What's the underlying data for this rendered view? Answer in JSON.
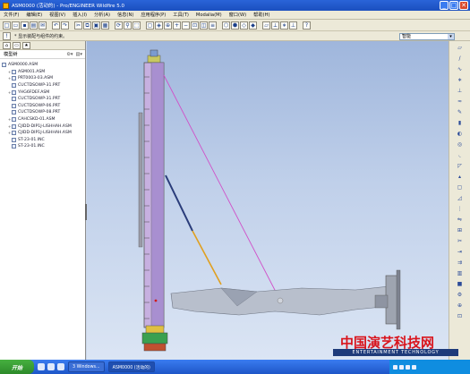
{
  "window": {
    "title": "ASM0000 (活动的) - Pro/ENGINEER Wildfire 5.0",
    "buttons": [
      "_",
      "□",
      "✕"
    ]
  },
  "menubar": {
    "items": [
      "文件(F)",
      "编辑(E)",
      "视图(V)",
      "插入(I)",
      "分析(A)",
      "信息(N)",
      "应用程序(P)",
      "工具(T)",
      "Modalia(M)",
      "窗口(W)",
      "帮助(H)"
    ]
  },
  "toolbar": {
    "message": "* 显示装配与组件的约束。",
    "smart_filter": "智能"
  },
  "model_tree": {
    "header": "模型树",
    "items": [
      {
        "label": "ASM0000.ASM",
        "level": 0
      },
      {
        "label": "ASM001.ASM",
        "level": 1
      },
      {
        "label": "PRT0003-03.ASM",
        "level": 1
      },
      {
        "label": "CUCTDSOWP-31.PRT",
        "level": 1
      },
      {
        "label": "YHG6FDEF.ASM",
        "level": 1
      },
      {
        "label": "CUCTDSOWP-31.PRT",
        "level": 1
      },
      {
        "label": "CUCTDSOWP-06.PRT",
        "level": 1
      },
      {
        "label": "CUCTDSOWP-08.PRT",
        "level": 1
      },
      {
        "label": "CAHCSKD-01.ASM",
        "level": 1
      },
      {
        "label": "CJIDD-DIP1J-LISHHAH.ASM",
        "level": 1
      },
      {
        "label": "CJIDD-DIP1J-LISHHAH.ASM",
        "level": 1
      },
      {
        "label": "ST-23-01.INC",
        "level": 1
      },
      {
        "label": "ST-23-01.INC",
        "level": 1
      }
    ]
  },
  "taskbar": {
    "start_label": "开始",
    "tasks": [
      "3 Windows...",
      "ASM0000 (活动的)"
    ]
  },
  "watermark": {
    "chinese": "中国演艺科技网",
    "english": "ENTERTAINMENT TECHNOLOGY"
  }
}
